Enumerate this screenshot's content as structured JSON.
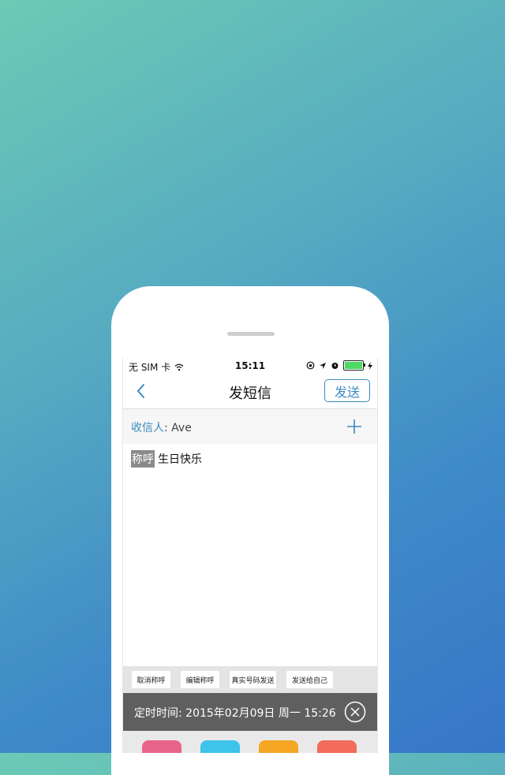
{
  "status": {
    "carrier": "无 SIM 卡",
    "time": "15:11"
  },
  "nav": {
    "title": "发短信",
    "send_label": "发送"
  },
  "recipient": {
    "label": "收信人",
    "separator": ": ",
    "name": "Ave"
  },
  "message": {
    "tag": "称呼",
    "text": "生日快乐"
  },
  "quick_buttons": [
    {
      "label": "取消称呼"
    },
    {
      "label": "编辑称呼"
    },
    {
      "label": "真实号码发送"
    },
    {
      "label": "发送给自己"
    }
  ],
  "schedule": {
    "label": "定时时间:",
    "value": "2015年02月09日 周一 15:26"
  },
  "colors": {
    "accent": "#3b8bc1",
    "battery": "#4cd964",
    "schedule_bg": "#5f5f5f",
    "app_icons": [
      "#e9648a",
      "#3ec3ea",
      "#f5a623",
      "#f26b5b"
    ]
  }
}
